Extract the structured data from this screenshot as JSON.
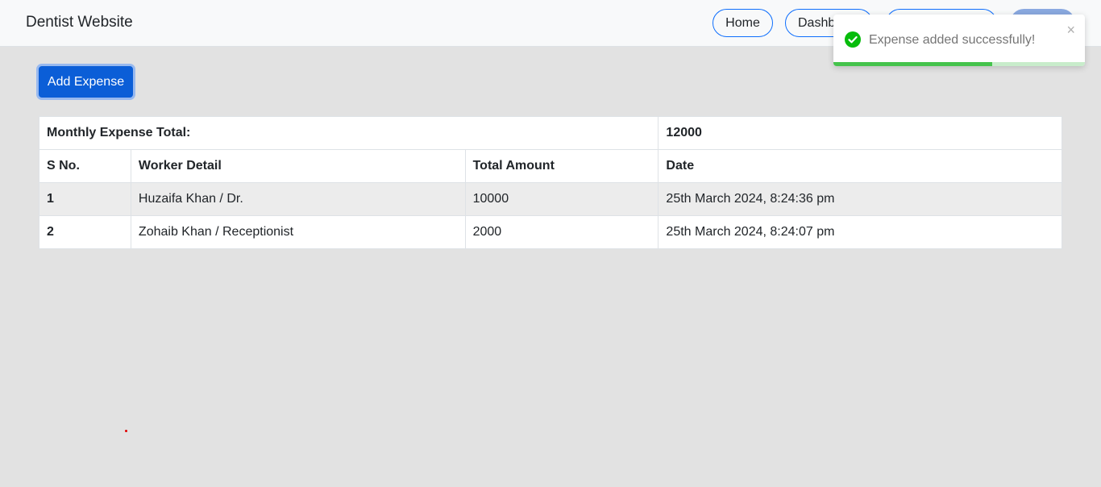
{
  "navbar": {
    "brand": "Dentist Website",
    "home_label": "Home",
    "dashboard_label": "Dashboard",
    "third_label": "",
    "fourth_label": ""
  },
  "main": {
    "add_button_label": "Add Expense"
  },
  "table": {
    "total_label": "Monthly Expense Total:",
    "total_value": "12000",
    "headers": [
      "S No.",
      "Worker Detail",
      "Total Amount",
      "Date"
    ],
    "rows": [
      {
        "sno": "1",
        "worker": "Huzaifa Khan / Dr.",
        "amount": "10000",
        "date": "25th March 2024, 8:24:36 pm"
      },
      {
        "sno": "2",
        "worker": "Zohaib Khan / Receptionist",
        "amount": "2000",
        "date": "25th March 2024, 8:24:07 pm"
      }
    ]
  },
  "toast": {
    "message": "Expense added successfully!",
    "close_glyph": "×",
    "icon": "check-circle-icon",
    "progress": 0.63,
    "color": "#07bc0c"
  }
}
